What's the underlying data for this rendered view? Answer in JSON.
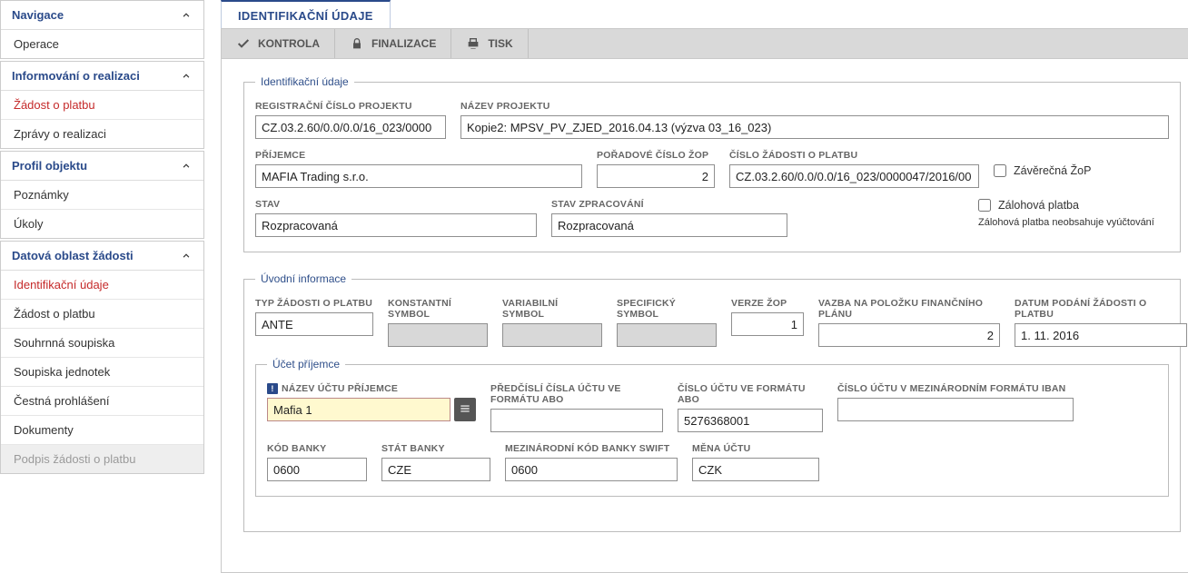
{
  "sidebar": {
    "navigace": {
      "title": "Navigace",
      "operace": "Operace"
    },
    "informovani": {
      "title": "Informování o realizaci",
      "zop": "Žádost o platbu",
      "zpravy": "Zprávy o realizaci"
    },
    "profil": {
      "title": "Profil objektu",
      "poznamky": "Poznámky",
      "ukoly": "Úkoly"
    },
    "datova": {
      "title": "Datová oblast žádosti",
      "ident": "Identifikační údaje",
      "zop": "Žádost o platbu",
      "souhrnna": "Souhrnná soupiska",
      "jednotek": "Soupiska jednotek",
      "cestna": "Čestná prohlášení",
      "dokumenty": "Dokumenty",
      "podpis": "Podpis žádosti o platbu"
    }
  },
  "tab": {
    "title": "IDENTIFIKAČNÍ ÚDAJE"
  },
  "toolbar": {
    "kontrola": "KONTROLA",
    "finalizace": "FINALIZACE",
    "tisk": "TISK"
  },
  "ident": {
    "legend": "Identifikační údaje",
    "reg_lbl": "REGISTRAČNÍ ČÍSLO PROJEKTU",
    "reg": "CZ.03.2.60/0.0/0.0/16_023/0000",
    "nazev_lbl": "NÁZEV PROJEKTU",
    "nazev": "Kopie2: MPSV_PV_ZJED_2016.04.13 (výzva 03_16_023)",
    "prijemce_lbl": "PŘÍJEMCE",
    "prijemce": "MAFIA Trading s.r.o.",
    "poradove_lbl": "POŘADOVÉ ČÍSLO ŽOP",
    "poradove": "2",
    "cislo_lbl": "ČÍSLO ŽÁDOSTI O PLATBU",
    "cislo": "CZ.03.2.60/0.0/0.0/16_023/0000047/2016/00",
    "zaverecna": "Závěrečná ŽoP",
    "stav_lbl": "STAV",
    "stav": "Rozpracovaná",
    "stav_zprac_lbl": "STAV ZPRACOVÁNÍ",
    "stav_zprac": "Rozpracovaná",
    "zalohova": "Zálohová platba",
    "zalohova_hint": "Zálohová platba neobsahuje vyúčtování"
  },
  "uvod": {
    "legend": "Úvodní informace",
    "typ_lbl": "TYP ŽÁDOSTI O PLATBU",
    "typ": "ANTE",
    "konst_lbl": "KONSTANTNÍ SYMBOL",
    "konst": "",
    "var_lbl": "VARIABILNÍ SYMBOL",
    "var": "",
    "spec_lbl": "SPECIFICKÝ SYMBOL",
    "spec": "",
    "verze_lbl": "VERZE ŽOP",
    "verze": "1",
    "vazba_lbl": "VAZBA NA POLOŽKU FINANČNÍHO PLÁNU",
    "vazba": "2",
    "datum_lbl": "DATUM PODÁNÍ ŽÁDOSTI O PLATBU",
    "datum": "1. 11. 2016",
    "ucet": {
      "legend": "Účet příjemce",
      "nazev_lbl": "NÁZEV ÚČTU PŘÍJEMCE",
      "nazev": "Mafia 1",
      "predcisli_lbl": "PŘEDČÍSLÍ ČÍSLA ÚČTU VE FORMÁTU ABO",
      "predcisli": "",
      "cisloabo_lbl": "ČÍSLO ÚČTU VE FORMÁTU ABO",
      "cisloabo": "5276368001",
      "iban_lbl": "ČÍSLO ÚČTU V MEZINÁRODNÍM FORMÁTU IBAN",
      "iban": "",
      "kod_lbl": "KÓD BANKY",
      "kod": "0600",
      "stat_lbl": "STÁT BANKY",
      "stat": "CZE",
      "swift_lbl": "MEZINÁRODNÍ KÓD BANKY SWIFT",
      "swift": "0600",
      "mena_lbl": "MĚNA ÚČTU",
      "mena": "CZK"
    }
  }
}
